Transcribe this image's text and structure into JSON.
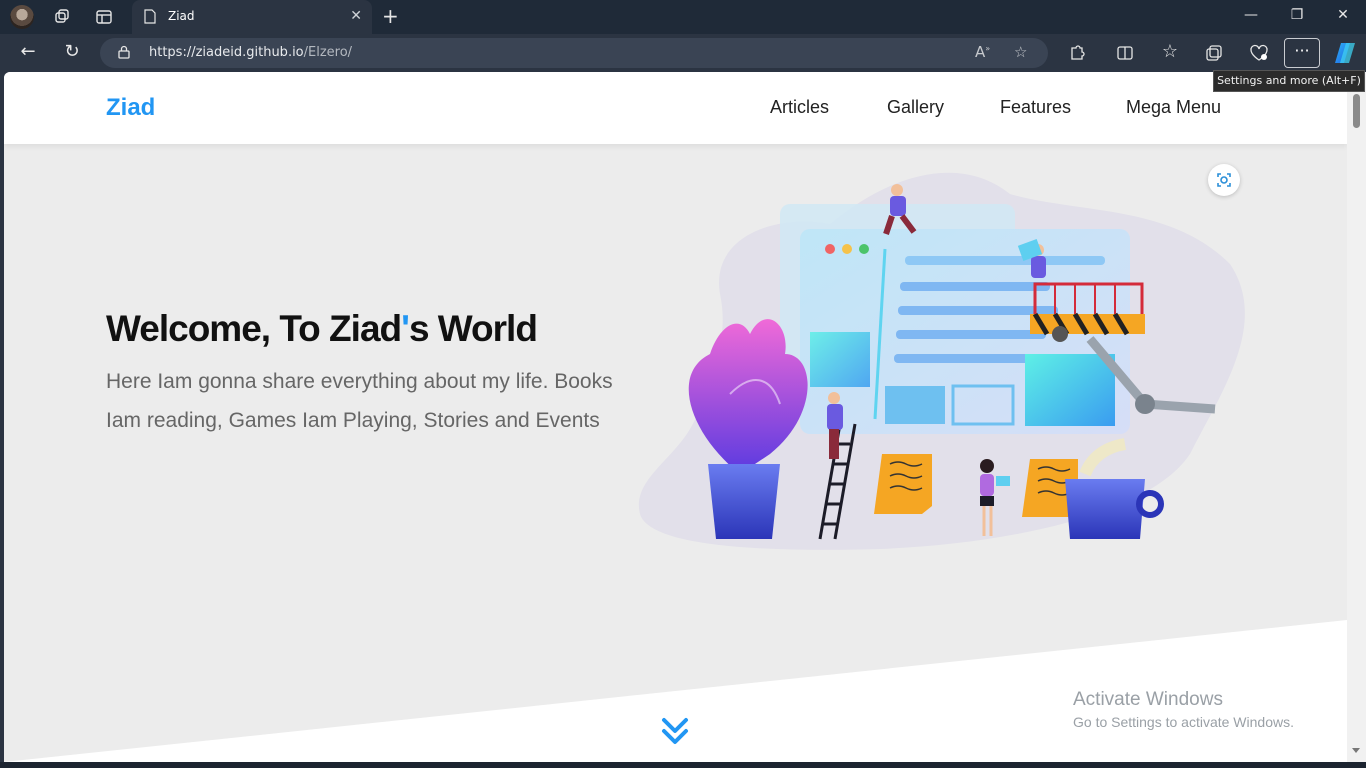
{
  "browser": {
    "tab": {
      "title": "Ziad"
    },
    "address": {
      "domain": "https://ziadeid.github.io",
      "path": "/Elzero/"
    },
    "tooltip": "Settings and more (Alt+F)",
    "menu_label": "···"
  },
  "site": {
    "logo": "Ziad",
    "nav": [
      "Articles",
      "Gallery",
      "Features",
      "Mega Menu"
    ],
    "hero": {
      "title_prefix": "Welcome, To Ziad",
      "title_apostrophe": "'",
      "title_suffix": "s World",
      "text": "Here Iam gonna share everything about my life. Books Iam reading, Games Iam Playing, Stories and Events"
    }
  },
  "watermark": {
    "title": "Activate Windows",
    "subtitle": "Go to Settings to activate Windows."
  },
  "colors": {
    "accent": "#2196f3",
    "hero_bg": "#ececec",
    "chrome_bg": "#2b3442"
  },
  "icons": [
    "profile-avatar",
    "workspaces-icon",
    "tab-actions-icon",
    "page-icon",
    "close-icon",
    "plus-icon",
    "minimize-icon",
    "restore-icon",
    "back-icon",
    "refresh-icon",
    "lock-icon",
    "read-aloud-icon",
    "favorite-star-icon",
    "extensions-icon",
    "split-screen-icon",
    "favorites-icon",
    "collections-icon",
    "browser-essentials-icon",
    "more-icon",
    "copilot-icon",
    "visual-search-icon",
    "double-chevron-down-icon"
  ]
}
